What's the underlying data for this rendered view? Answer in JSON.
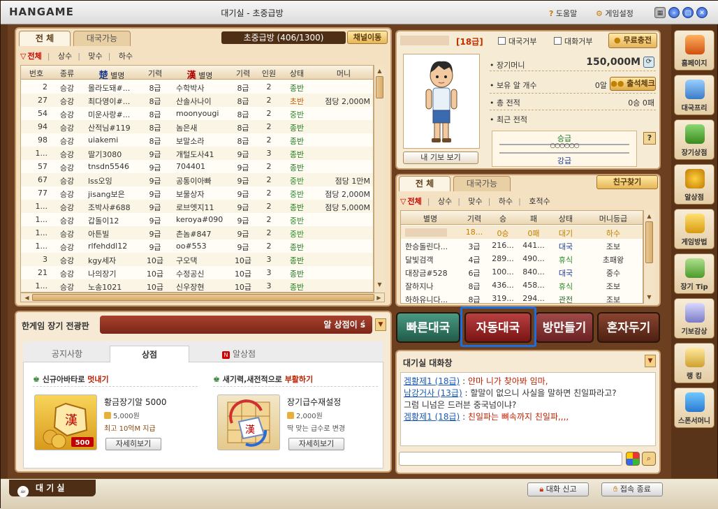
{
  "window": {
    "logo": "HANGAME",
    "title": "대기실 - 초중급방",
    "help_label": "도움말",
    "settings_label": "게임설정"
  },
  "room_list": {
    "tabs": [
      "전 체",
      "대국가능"
    ],
    "room_title": "초중급방 (406/1300)",
    "channel_button": "채널이동",
    "filters": [
      "전체",
      "상수",
      "맞수",
      "하수"
    ],
    "columns": [
      "번호",
      "종류",
      "별명",
      "기력",
      "별명",
      "기력",
      "인원",
      "상태",
      "머니"
    ],
    "rows": [
      [
        "2",
        "승강",
        "몰라도돼#...",
        "8급",
        "수학박사",
        "8급",
        "2",
        "종반",
        ""
      ],
      [
        "27",
        "승강",
        "최다영이#...",
        "8급",
        "산솔사나이",
        "8급",
        "2",
        "초반",
        "점당 2,000M"
      ],
      [
        "54",
        "승강",
        "미운사랑#...",
        "8급",
        "moonyougi",
        "8급",
        "2",
        "중반",
        ""
      ],
      [
        "94",
        "승강",
        "산적님#119",
        "8급",
        "놈은새",
        "8급",
        "2",
        "종반",
        ""
      ],
      [
        "98",
        "승강",
        "uiakemi",
        "8급",
        "보말소라",
        "8급",
        "2",
        "종반",
        ""
      ],
      [
        "1...",
        "승강",
        "딸기3080",
        "9급",
        "개털도사41",
        "9급",
        "3",
        "종반",
        ""
      ],
      [
        "57",
        "승강",
        "tnsdn5546",
        "9급",
        "704401",
        "9급",
        "2",
        "종반",
        ""
      ],
      [
        "67",
        "승강",
        "lss오잉",
        "9급",
        "공통이아빠",
        "9급",
        "2",
        "중반",
        "점당 1만M"
      ],
      [
        "77",
        "승강",
        "jisang보은",
        "9급",
        "보물상자",
        "9급",
        "2",
        "중반",
        "점당 2,000M"
      ],
      [
        "1...",
        "승강",
        "조박사#688",
        "9급",
        "로브엣지11",
        "9급",
        "2",
        "종반",
        "점당 5,000M"
      ],
      [
        "1...",
        "승강",
        "갑돌이12",
        "9급",
        "keroya#090",
        "9급",
        "2",
        "중반",
        ""
      ],
      [
        "1...",
        "승강",
        "아튼빌",
        "9급",
        "촌놈#847",
        "9급",
        "2",
        "중반",
        ""
      ],
      [
        "1...",
        "승강",
        "rlfehddl12",
        "9급",
        "oo#553",
        "9급",
        "2",
        "종반",
        ""
      ],
      [
        "3",
        "승강",
        "kgy세자",
        "10급",
        "구오댁",
        "10급",
        "3",
        "종반",
        ""
      ],
      [
        "21",
        "승강",
        "나의장기",
        "10급",
        "수정공신",
        "10급",
        "3",
        "종반",
        ""
      ],
      [
        "1...",
        "승강",
        "노송1021",
        "10급",
        "신우장현",
        "10급",
        "3",
        "종반",
        ""
      ]
    ]
  },
  "bulletin": {
    "title": "한게임 장기 전광판",
    "ticker": "알 상점이 ś",
    "tabs": [
      "공지사항",
      "상점",
      "알상점"
    ],
    "promo1_title": "신규아바타로 ",
    "promo1_red": "멋내기",
    "promo2_title": "새기력,새전적으로 ",
    "promo2_red": "부활하기",
    "product1": {
      "name": "황금장기알 5000",
      "price": "5,000원",
      "note": "최고 10억M 지급",
      "button": "자세히보기",
      "badge": "500"
    },
    "product2": {
      "name": "장기급수재설정",
      "price": "2,000원",
      "note": "딱 맞는 급수로 변경",
      "button": "자세히보기"
    }
  },
  "profile": {
    "grade": "[18급]",
    "opt_no_game": "대국거부",
    "opt_no_chat": "대화거부",
    "free_charge": "무료충전",
    "money_label": "장기머니",
    "money_value": "150,000M",
    "eggs_label": "보유 알 개수",
    "eggs_value": "0알",
    "attend_button": "출석체크",
    "total_label": "총 전적",
    "total_value": "0승 0패",
    "recent_label": "최근 전적",
    "promote": "승급",
    "demote": "강급",
    "gibo_button": "내 기보 보기"
  },
  "user_list": {
    "tabs": [
      "전 체",
      "대국가능"
    ],
    "friend_button": "친구찾기",
    "filters": [
      "전체",
      "상수",
      "맞수",
      "하수",
      "호적수"
    ],
    "columns": [
      "별명",
      "기력",
      "승",
      "패",
      "상태",
      "머니등급"
    ],
    "rows": [
      [
        "",
        "18...",
        "0승",
        "0패",
        "대기",
        "하수"
      ],
      [
        "한승돌린다...",
        "3급",
        "216...",
        "441...",
        "대국",
        "조보"
      ],
      [
        "달빛검객",
        "4급",
        "289...",
        "490...",
        "휴식",
        "초패왕"
      ],
      [
        "대장금#528",
        "6급",
        "100...",
        "840...",
        "대국",
        "중수"
      ],
      [
        "잘하지나",
        "8급",
        "436...",
        "458...",
        "휴식",
        "조보"
      ],
      [
        "하하유니다...",
        "8급",
        "319...",
        "294...",
        "관전",
        "조보"
      ]
    ]
  },
  "actions": {
    "quick": "빠른대국",
    "auto": "자동대국",
    "make_room": "방만들기",
    "solo": "혼자두기"
  },
  "chat": {
    "title": "대기실 대화창",
    "lines": [
      {
        "name": "겜황제1 (18급)",
        "sep": " : ",
        "text": "얀마 니가 찾아봐 임마,",
        "red": true
      },
      {
        "name": "남강거사 (13급)",
        "sep": " : ",
        "text": "할말이 없으니 사실을 말하면 친일파라고?",
        "red": false
      },
      {
        "name": "",
        "sep": "",
        "text": "그럼 니넘은 드러븐 중국넘이냐?",
        "red": false
      },
      {
        "name": "겜황제1 (18급)",
        "sep": " : ",
        "text": "친일파는 뼈속까지 친일파,,,,",
        "red": true
      }
    ]
  },
  "sidebar": [
    "홈페이지",
    "대국프리",
    "장기상점",
    "알상점",
    "게임방법",
    "장기 Tip",
    "기보감상",
    "랭 킹",
    "스폰서머니"
  ],
  "bottom": {
    "tab": "대 기 실",
    "report": "대화 신고",
    "exit": "접속 종료"
  },
  "colors": {
    "frame": "#5a3418",
    "quick": "#2f6e5a",
    "auto": "#8b1c1c",
    "make_room": "#7a2f2f",
    "solo": "#5e2a1a",
    "highlight": "#1a6ee0"
  }
}
